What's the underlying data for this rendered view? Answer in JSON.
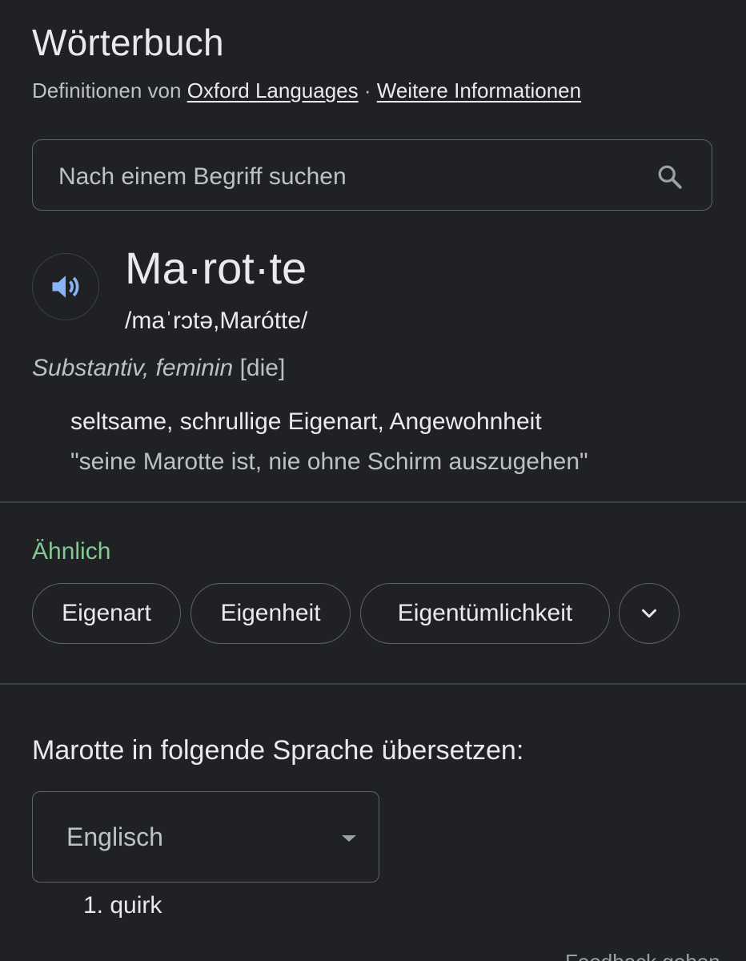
{
  "header": {
    "title": "Wörterbuch",
    "source_prefix": "Definitionen von",
    "source_link": "Oxford Languages",
    "separator": "·",
    "more_info_link": "Weitere Informationen"
  },
  "search": {
    "placeholder": "Nach einem Begriff suchen",
    "value": "",
    "icon": "search-icon"
  },
  "entry": {
    "audio_icon": "speaker-icon",
    "headword": "Ma·rot·te",
    "pronunciation": "/maˈrɔtə,Marótte/",
    "part_of_speech": "Substantiv, feminin",
    "article": "[die]",
    "definition": "seltsame, schrullige Eigenart, Angewohnheit",
    "example": "\"seine Marotte ist, nie ohne Schirm auszugehen\""
  },
  "similar": {
    "label": "Ähnlich",
    "chips": [
      "Eigenart",
      "Eigenheit",
      "Eigentümlichkeit"
    ],
    "expand_icon": "chevron-down-icon"
  },
  "translate": {
    "label": "Marotte in folgende Sprache übersetzen:",
    "selected_language": "Englisch",
    "results": [
      "1. quirk"
    ]
  },
  "footer": {
    "partial_text": "Feedback geben"
  },
  "colors": {
    "background": "#202124",
    "text_primary": "#e8eaed",
    "text_secondary": "#bdc1c6",
    "accent_green": "#81c995",
    "speaker_blue": "#8ab4f8",
    "border": "#5f6368"
  }
}
